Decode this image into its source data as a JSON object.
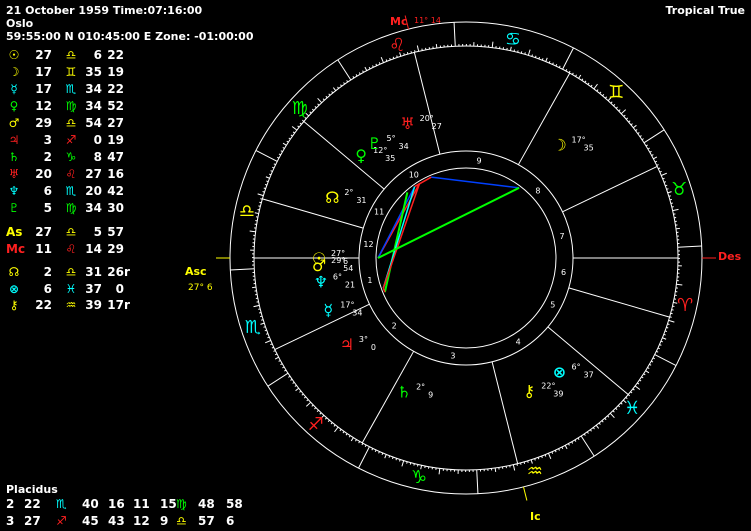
{
  "header": {
    "date_time": "21 October 1959 Time:07:16:00",
    "place": "Oslo",
    "coords": "59:55:00 N 010:45:00 E Zone: -01:00:00",
    "zodiac": "Tropical True"
  },
  "planets": [
    {
      "glyph": "☉",
      "color": "#ffff00",
      "deg": "27",
      "sign": "♎",
      "sign_color": "#ffff00",
      "min": "6",
      "sec": "22",
      "retro": ""
    },
    {
      "glyph": "☽",
      "color": "#ffff00",
      "deg": "17",
      "sign": "♊",
      "sign_color": "#ffff00",
      "min": "35",
      "sec": "19",
      "retro": ""
    },
    {
      "glyph": "☿",
      "color": "#00ffff",
      "deg": "17",
      "sign": "♏",
      "sign_color": "#00ffff",
      "min": "34",
      "sec": "22",
      "retro": ""
    },
    {
      "glyph": "♀",
      "color": "#00ff00",
      "deg": "12",
      "sign": "♍",
      "sign_color": "#00ff00",
      "min": "34",
      "sec": "52",
      "retro": ""
    },
    {
      "glyph": "♂",
      "color": "#ffff00",
      "deg": "29",
      "sign": "♎",
      "sign_color": "#ffff00",
      "min": "54",
      "sec": "27",
      "retro": ""
    },
    {
      "glyph": "♃",
      "color": "#ff2020",
      "deg": "3",
      "sign": "♐",
      "sign_color": "#ff2020",
      "min": "0",
      "sec": "19",
      "retro": ""
    },
    {
      "glyph": "♄",
      "color": "#00ff00",
      "deg": "2",
      "sign": "♑",
      "sign_color": "#00ff00",
      "min": "8",
      "sec": "47",
      "retro": ""
    },
    {
      "glyph": "♅",
      "color": "#ff2020",
      "deg": "20",
      "sign": "♌",
      "sign_color": "#ff2020",
      "min": "27",
      "sec": "16",
      "retro": ""
    },
    {
      "glyph": "♆",
      "color": "#00ffff",
      "deg": "6",
      "sign": "♏",
      "sign_color": "#00ffff",
      "min": "20",
      "sec": "42",
      "retro": ""
    },
    {
      "glyph": "♇",
      "color": "#00ff00",
      "deg": "5",
      "sign": "♍",
      "sign_color": "#00ff00",
      "min": "34",
      "sec": "30",
      "retro": ""
    },
    {
      "glyph": "As",
      "color": "#ffff00",
      "deg": "27",
      "sign": "♎",
      "sign_color": "#ffff00",
      "min": "5",
      "sec": "57",
      "retro": ""
    },
    {
      "glyph": "Mc",
      "color": "#ff2020",
      "deg": "11",
      "sign": "♌",
      "sign_color": "#ff2020",
      "min": "14",
      "sec": "29",
      "retro": ""
    },
    {
      "glyph": "☊",
      "color": "#ffff00",
      "deg": "2",
      "sign": "♎",
      "sign_color": "#ffff00",
      "min": "31",
      "sec": "26",
      "retro": "r"
    },
    {
      "glyph": "⊗",
      "color": "#00ffff",
      "deg": "6",
      "sign": "♓",
      "sign_color": "#00ffff",
      "min": "37",
      "sec": "0",
      "retro": ""
    },
    {
      "glyph": "⚷",
      "color": "#ffff00",
      "deg": "22",
      "sign": "♒",
      "sign_color": "#ffff00",
      "min": "39",
      "sec": "17",
      "retro": "r"
    }
  ],
  "houses_footer": {
    "system": "Placidus",
    "rows": [
      {
        "h1": "2",
        "d1": "22",
        "s1": "♏",
        "s1c": "#00ffff",
        "m1": "40",
        "h2": "16",
        "d2": "11",
        "h3": "15",
        "s3": "♍",
        "s3c": "#00ff00",
        "m3": "48",
        "x3": "58"
      },
      {
        "h1": "3",
        "d1": "27",
        "s1": "♐",
        "s1c": "#ff2020",
        "m1": "45",
        "h2": "43",
        "d2": "12",
        "h3": "9",
        "s3": "♎",
        "s3c": "#ffff00",
        "m3": "57",
        "x3": "6"
      }
    ]
  },
  "wheel": {
    "signs": [
      {
        "glyph": "♈",
        "color": "#ff2020"
      },
      {
        "glyph": "♉",
        "color": "#00ff00"
      },
      {
        "glyph": "♊",
        "color": "#ffff00"
      },
      {
        "glyph": "♋",
        "color": "#00ffff"
      },
      {
        "glyph": "♌",
        "color": "#ff2020"
      },
      {
        "glyph": "♍",
        "color": "#00ff00"
      },
      {
        "glyph": "♎",
        "color": "#ffff00"
      },
      {
        "glyph": "♏",
        "color": "#00ffff"
      },
      {
        "glyph": "♐",
        "color": "#ff2020"
      },
      {
        "glyph": "♑",
        "color": "#00ff00"
      },
      {
        "glyph": "♒",
        "color": "#ffff00"
      },
      {
        "glyph": "♓",
        "color": "#00ffff"
      }
    ],
    "angles": {
      "mc": {
        "label": "Mc",
        "deg": "11",
        "min": "14",
        "color": "#ff2020"
      },
      "ic": {
        "label": "Ic",
        "color": "#ffff00"
      },
      "asc": {
        "label": "Asc",
        "deg": "27",
        "min": "6",
        "color": "#ffff00"
      },
      "des": {
        "label": "Des",
        "color": "#ff2020"
      }
    },
    "house_numbers": [
      "1",
      "2",
      "3",
      "4",
      "5",
      "6",
      "7",
      "8",
      "9",
      "10",
      "11",
      "12"
    ],
    "bodies": [
      {
        "glyph": "☉",
        "color": "#ffff00",
        "deg": "27",
        "min": "6"
      },
      {
        "glyph": "♂",
        "color": "#ffff00",
        "deg": "29",
        "min": "54"
      },
      {
        "glyph": "♆",
        "color": "#00ffff",
        "deg": "6",
        "min": "21"
      },
      {
        "glyph": "☿",
        "color": "#00ffff",
        "deg": "17",
        "min": "34"
      },
      {
        "glyph": "♃",
        "color": "#ff2020",
        "deg": "3",
        "min": "0"
      },
      {
        "glyph": "♄",
        "color": "#00ff00",
        "deg": "2",
        "min": "9"
      },
      {
        "glyph": "☽",
        "color": "#ffff00",
        "deg": "17",
        "min": "35"
      },
      {
        "glyph": "♅",
        "color": "#ff2020",
        "deg": "20",
        "min": "27"
      },
      {
        "glyph": "♀",
        "color": "#00ff00",
        "deg": "12",
        "min": "35"
      },
      {
        "glyph": "♇",
        "color": "#00ff00",
        "deg": "5",
        "min": "34"
      },
      {
        "glyph": "☊",
        "color": "#ffff00",
        "deg": "2",
        "min": "31"
      },
      {
        "glyph": "⚷",
        "color": "#ffff00",
        "deg": "22",
        "min": "39"
      },
      {
        "glyph": "⊗",
        "color": "#00ffff",
        "deg": "6",
        "min": "37"
      }
    ]
  }
}
